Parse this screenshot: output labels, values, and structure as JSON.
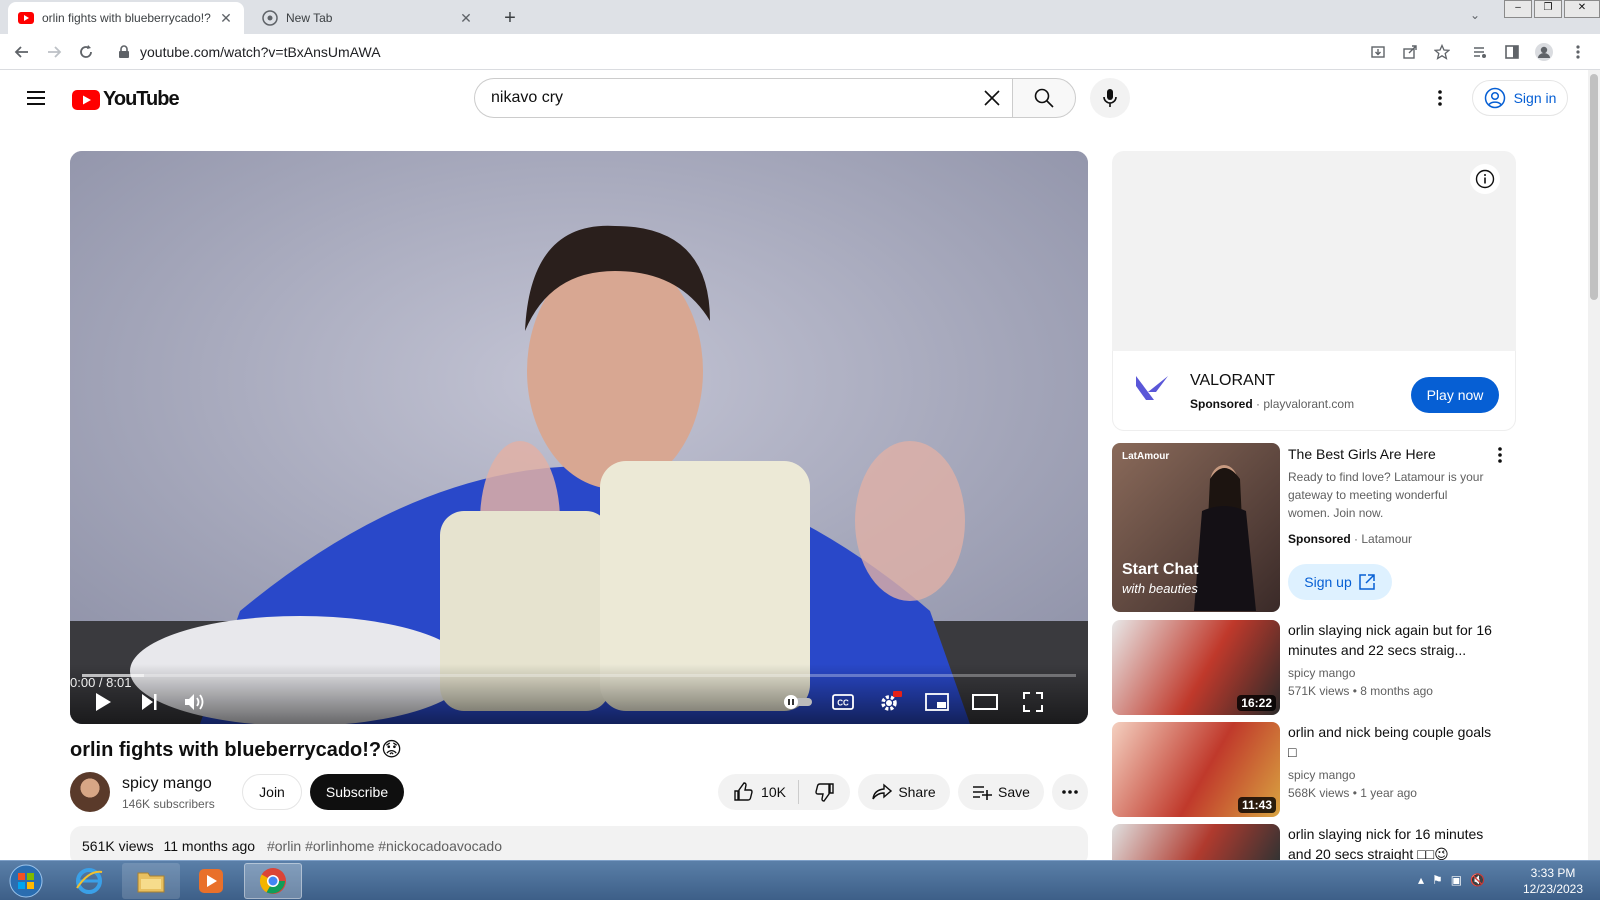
{
  "browser": {
    "tabs": [
      {
        "title": "orlin fights with blueberrycado!?",
        "active": true
      },
      {
        "title": "New Tab",
        "active": false
      }
    ],
    "url": "youtube.com/watch?v=tBxAnsUmAWA"
  },
  "header": {
    "logo_text": "YouTube",
    "search_value": "nikavo cry",
    "signin_label": "Sign in"
  },
  "player": {
    "time": "0:00 / 8:01",
    "progress_fraction": 0
  },
  "video": {
    "title": "orlin fights with blueberrycado!?😟",
    "channel": "spicy mango",
    "subscribers": "146K subscribers",
    "join_label": "Join",
    "subscribe_label": "Subscribe",
    "likes": "10K",
    "share_label": "Share",
    "save_label": "Save",
    "views": "561K views",
    "age": "11 months ago",
    "tags": "#orlin #orlinhome #nickocadoavocado"
  },
  "ad": {
    "name": "VALORANT",
    "sponsored": "Sponsored",
    "domain": "playvalorant.com",
    "cta": "Play now"
  },
  "sponsored_card": {
    "thumb_brand": "LatAmour",
    "thumb_line1": "Start Chat",
    "thumb_line2": "with beauties",
    "title": "The Best Girls Are Here",
    "desc": "Ready to find love? Latamour is your gateway to meeting wonderful women. Join now.",
    "sponsored": "Sponsored",
    "advertiser": "Latamour",
    "cta": "Sign up"
  },
  "recommendations": [
    {
      "title": "orlin slaying nick again but for 16 minutes and 22 secs straig...",
      "channel": "spicy mango",
      "views": "571K views",
      "age": "8 months ago",
      "duration": "16:22"
    },
    {
      "title": "orlin and nick being couple goals □",
      "channel": "spicy mango",
      "views": "568K views",
      "age": "1 year ago",
      "duration": "11:43"
    },
    {
      "title": "orlin slaying nick for 16 minutes and 20 secs straight □□😉",
      "channel": "",
      "views": "",
      "age": "",
      "duration": ""
    }
  ],
  "taskbar": {
    "time": "3:33 PM",
    "date": "12/23/2023"
  },
  "colors": {
    "yt_red": "#ff0000",
    "link_blue": "#065fd4",
    "taskbar": "#3d5f88"
  }
}
